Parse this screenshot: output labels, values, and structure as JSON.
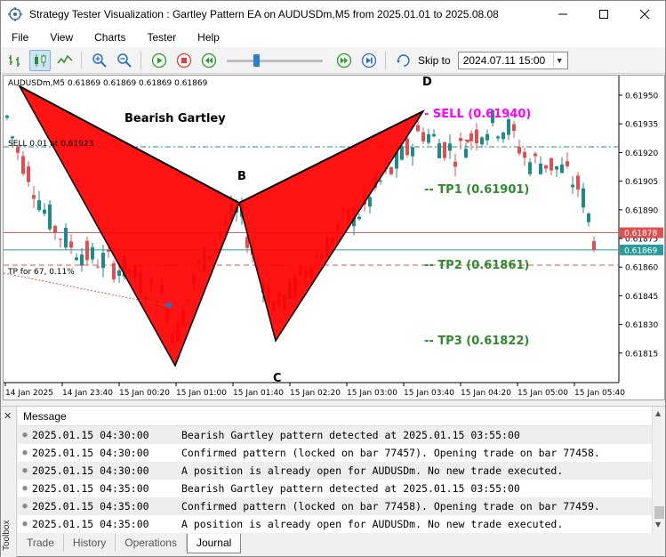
{
  "window": {
    "title": "Strategy Tester Visualization : Gartley Pattern EA on AUDUSDm,M5 from 2025.01.01 to 2025.08.08",
    "minimize_icon": "minimize-icon",
    "maximize_icon": "maximize-icon",
    "close_icon": "close-icon"
  },
  "menu": [
    "File",
    "View",
    "Charts",
    "Tester",
    "Help"
  ],
  "toolbar": {
    "skip_label": "Skip to",
    "skip_date": "2024.07.11 15:00",
    "speed_level": 0.3
  },
  "chart": {
    "symbol_info": "AUDUSDm,M5  0.61869 0.61869 0.61869 0.61869",
    "pattern_title": "Bearish Gartley",
    "point_labels": {
      "B": "B",
      "C": "C",
      "D": "D"
    },
    "sell_label": "SELL (0.61940)",
    "sell_order_label": "SELL 0.01 at 0.61923",
    "tp_note": "TP for 67, 0.11%",
    "tp1_label": "TP1 (0.61901)",
    "tp2_label": "TP2 (0.61861)",
    "tp3_label": "TP3 (0.61822)",
    "price_ticks": [
      "0.61950",
      "0.61935",
      "0.61920",
      "0.61905",
      "0.61890",
      "0.61875",
      "0.61860",
      "0.61845",
      "0.61830",
      "0.61815"
    ],
    "price_tags": [
      "0.61878",
      "0.61869"
    ],
    "time_ticks": [
      "14 Jan 2025",
      "14 Jan 23:40",
      "15 Jan 00:20",
      "15 Jan 01:00",
      "15 Jan 01:40",
      "15 Jan 02:20",
      "15 Jan 03:00",
      "15 Jan 03:40",
      "15 Jan 04:20",
      "15 Jan 05:00",
      "15 Jan 05:40"
    ],
    "colors": {
      "bull": "#1f8a8a",
      "bear": "#e05050",
      "pattern_fill": "#ff0000",
      "tp": "#2e8b2e",
      "sell": "#ff00ff"
    }
  },
  "log": {
    "header": "Message",
    "rows": [
      {
        "time": "2025.01.15 04:30:00",
        "message": "Bearish Gartley pattern detected at 2025.01.15 03:55:00"
      },
      {
        "time": "2025.01.15 04:30:00",
        "message": "Confirmed pattern (locked on bar 77457). Opening trade on bar 77458."
      },
      {
        "time": "2025.01.15 04:30:00",
        "message": "A position is already open for AUDUSDm. No new trade executed."
      },
      {
        "time": "2025.01.15 04:35:00",
        "message": "Bearish Gartley pattern detected at 2025.01.15 03:55:00"
      },
      {
        "time": "2025.01.15 04:35:00",
        "message": "Confirmed pattern (locked on bar 77458). Opening trade on bar 77459."
      },
      {
        "time": "2025.01.15 04:35:00",
        "message": "A position is already open for AUDUSDm. No new trade executed."
      }
    ]
  },
  "toolbox_label": "Toolbox",
  "tabs": [
    "Trade",
    "History",
    "Operations",
    "Journal"
  ],
  "active_tab": "Journal"
}
